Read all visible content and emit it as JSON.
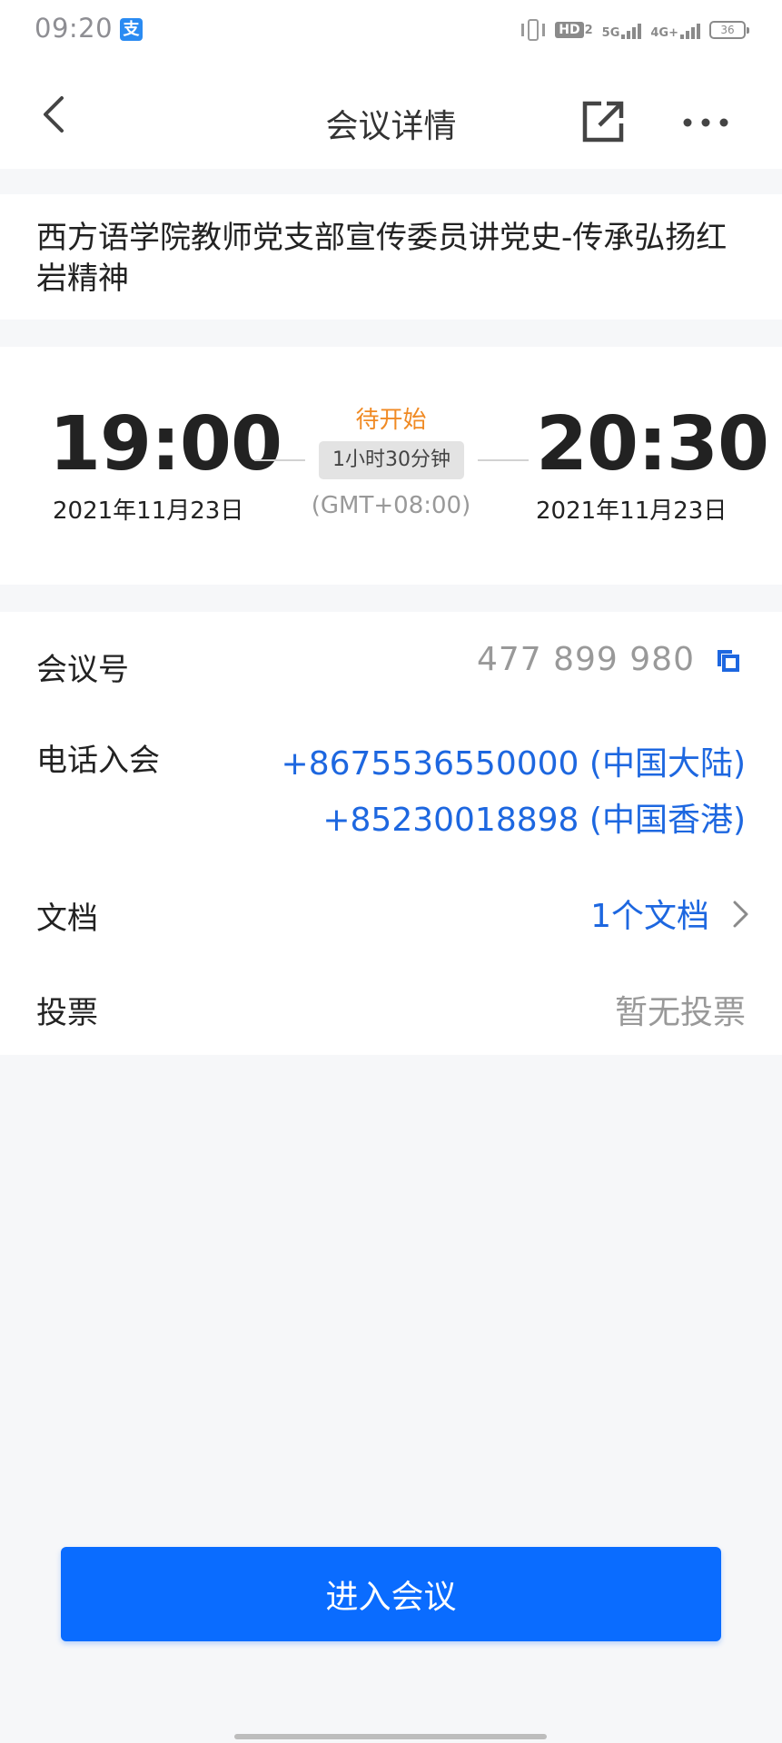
{
  "status_bar": {
    "time": "09:20",
    "app_icon_char": "支",
    "hd_label": "HD",
    "hd_sub": "2",
    "net_5g": "5G",
    "net_4g": "4G+",
    "battery": "36",
    "icons": [
      "vibrate-icon",
      "hd-icon",
      "signal-5g-icon",
      "signal-4g-icon",
      "battery-icon"
    ]
  },
  "nav": {
    "title": "会议详情",
    "icons": [
      "back-icon",
      "share-icon",
      "more-icon"
    ]
  },
  "meeting": {
    "title": "西方语学院教师党支部宣传委员讲党史-传承弘扬红岩精神",
    "start_time": "19:00",
    "start_date": "2021年11月23日",
    "end_time": "20:30",
    "end_date": "2021年11月23日",
    "status": "待开始",
    "duration": "1小时30分钟",
    "timezone": "(GMT+08:00)"
  },
  "details": {
    "meeting_id_label": "会议号",
    "meeting_id": "477 899 980",
    "phone_label": "电话入会",
    "phones": [
      "+8675536550000 (中国大陆)",
      "+85230018898 (中国香港)"
    ],
    "doc_label": "文档",
    "doc_value": "1个文档",
    "vote_label": "投票",
    "vote_value": "暂无投票"
  },
  "actions": {
    "join_label": "进入会议"
  },
  "colors": {
    "accent": "#0a6cff",
    "link": "#1d67e0",
    "status_pending": "#f08a24",
    "background": "#f6f7f9"
  }
}
